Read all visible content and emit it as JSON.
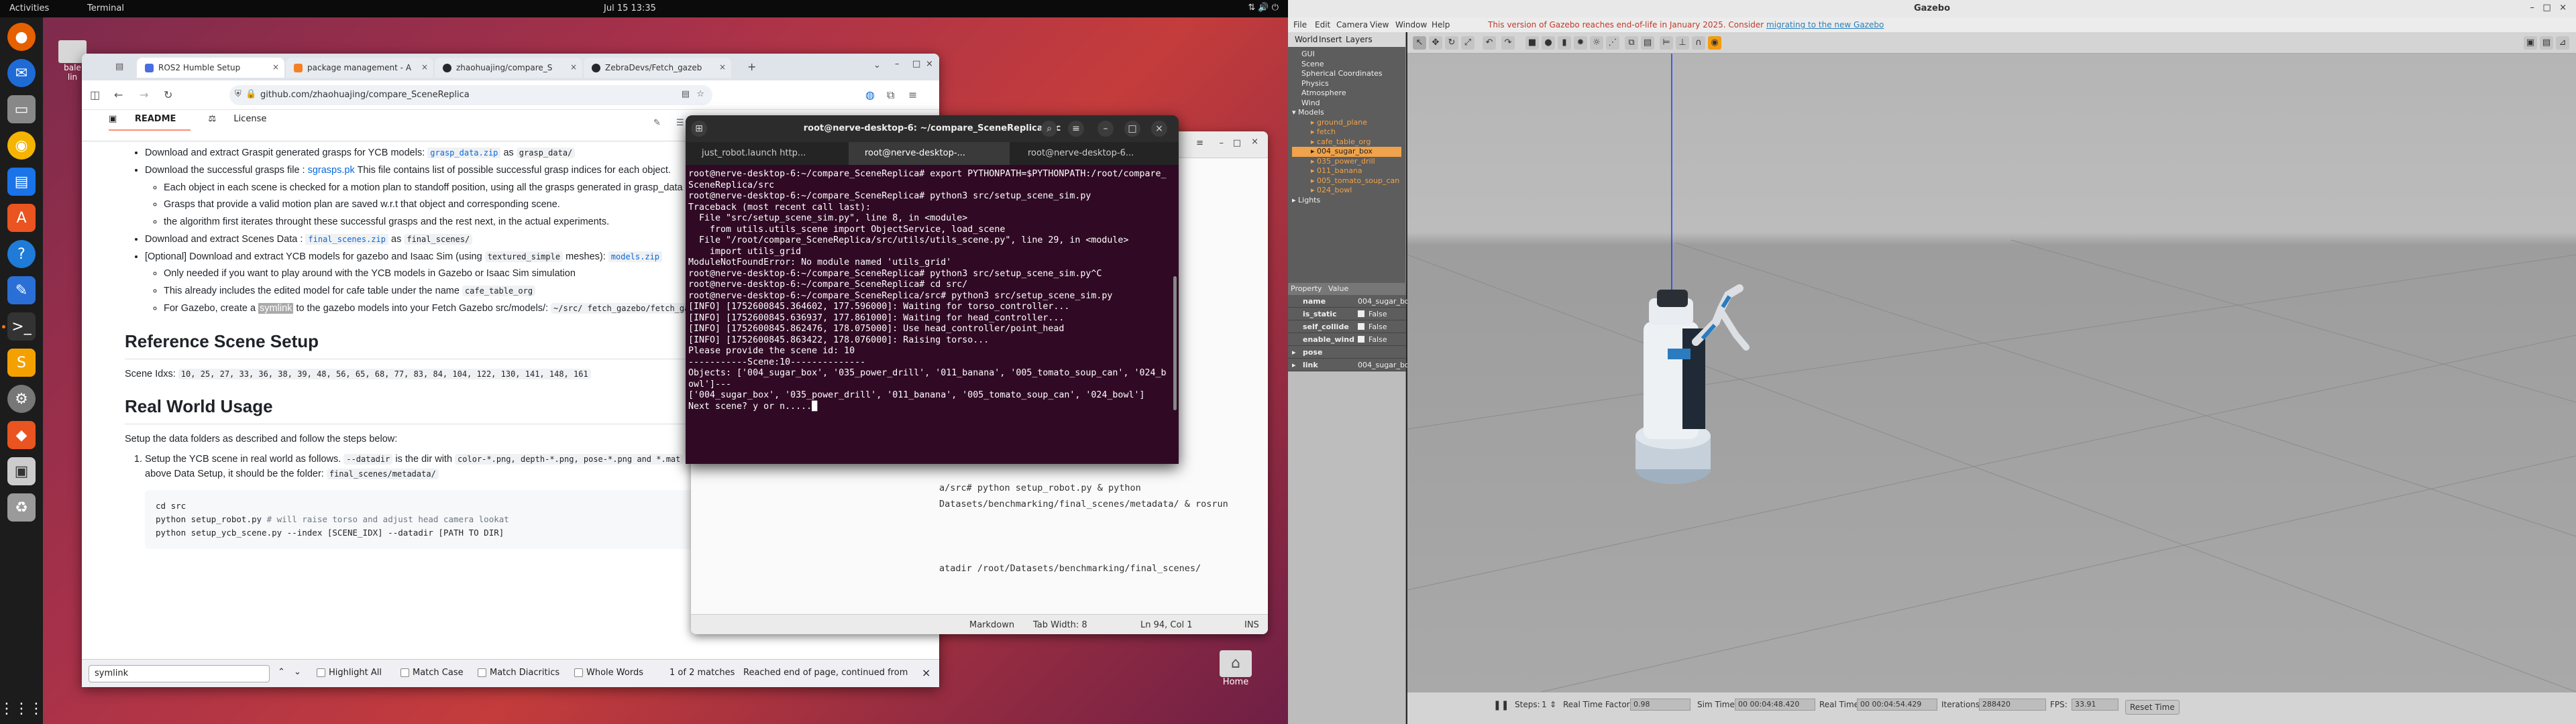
{
  "topbar": {
    "activities": "Activities",
    "app": "Terminal",
    "clock": "Jul 15  13:35"
  },
  "desktop": {
    "folder_label": "bale\nlin",
    "home_label": "Home"
  },
  "browser": {
    "tabs": [
      {
        "label": "ROS2 Humble Setup",
        "color": "#4a6ee0"
      },
      {
        "label": "package management - A",
        "color": "#f48024"
      },
      {
        "label": "zhaohuajing/compare_S",
        "color": "#24292f"
      },
      {
        "label": "ZebraDevs/Fetch_gazeb",
        "color": "#24292f"
      }
    ],
    "url": "github.com/zhaohuajing/compare_SceneReplica",
    "readme_tab": "README",
    "license_tab": "License",
    "doc": {
      "b1_pre": "Download and extract Graspit generated grasps for YCB models: ",
      "b1_code1": "grasp_data.zip",
      "b1_mid": " as ",
      "b1_code2": "grasp_data/",
      "b2_pre": "Download the successful grasps file : ",
      "b2_link": "sgrasps.pk",
      "b2_post": " This file contains list of possible successful grasp indices for each object.",
      "s1": "Each object in each scene is checked for a motion plan to standoff position, using all the grasps generated in grasp_data",
      "s2": "Grasps that provide a valid motion plan are saved w.r.t that object and corresponding scene.",
      "s3": "the algorithm first iterates throught these successful grasps and the rest next, in the actual experiments.",
      "b3_pre": "Download and extract Scenes Data : ",
      "b3_code1": "final_scenes.zip",
      "b3_mid": " as ",
      "b3_code2": "final_scenes/",
      "b4_pre": "[Optional] Download and extract YCB models for gazebo and Isaac Sim (using ",
      "b4_code": "textured_simple",
      "b4_post": " meshes): ",
      "b4_link": "models.zip",
      "o1": "Only needed if you want to play around with the YCB models in Gazebo or Isaac Sim simulation",
      "o2_pre": "This already includes the edited model for cafe table under the name ",
      "o2_code": "cafe_table_org",
      "o3_pre": "For Gazebo, create a ",
      "o3_hl": "symlink",
      "o3_mid": " to the gazebo models into your Fetch Gazebo src/models/: ",
      "o3_code": "~/src/ fetch_gazebo/fetch_gazebo/models",
      "h_ref": "Reference Scene Setup",
      "scene_label": "Scene Idxs: ",
      "scene_idxs": "10, 25, 27, 33, 36, 38, 39, 48, 56, 65, 68, 77, 83, 84, 104, 122, 130, 141, 148, 161",
      "h_real": "Real World Usage",
      "real_p": "Setup the data folders as described and follow the steps below:",
      "ol1_pre": "Setup the YCB scene in real world as follows. ",
      "ol1_c1": "--datadir",
      "ol1_mid": " is the dir with ",
      "ol1_c2": "color-*.png, depth-*.png, pose-*.png and *.mat",
      "ol1_mid2": " info files. Using the above Data Setup, it should be the folder: ",
      "ol1_c3": "final_scenes/metadata/",
      "code_l1": "cd src",
      "code_l2": "python setup_robot.py ",
      "code_l2c": "# will raise torso and adjust head camera lookat",
      "code_l3": "python setup_ycb_scene.py --index [SCENE_IDX] --datadir [PATH TO DIR]"
    },
    "find": {
      "value": "symlink",
      "highlight_all": "Highlight All",
      "match_case": "Match Case",
      "match_diacritics": "Match Diacritics",
      "whole_words": "Whole Words",
      "count": "1 of 2 matches",
      "status": "Reached end of page, continued from"
    }
  },
  "editor": {
    "lines": "a/src# python setup_robot.py & python\nDatasets/benchmarking/final_scenes/metadata/ & rosrun\n\n\n\natadir /root/Datasets/benchmarking/final_scenes/",
    "status": {
      "lang": "Markdown",
      "tab": "Tab Width: 8",
      "pos": "Ln 94, Col 1",
      "ins": "INS"
    }
  },
  "terminal": {
    "title": "root@nerve-desktop-6: ~/compare_SceneReplica/src",
    "tabs": [
      "just_robot.launch http...",
      "root@nerve-desktop-...",
      "root@nerve-desktop-6..."
    ],
    "output": "root@nerve-desktop-6:~/compare_SceneReplica# export PYTHONPATH=$PYTHONPATH:/root/compare_SceneReplica/src\nroot@nerve-desktop-6:~/compare_SceneReplica# python3 src/setup_scene_sim.py\nTraceback (most recent call last):\n  File \"src/setup_scene_sim.py\", line 8, in <module>\n    from utils.utils_scene import ObjectService, load_scene\n  File \"/root/compare_SceneReplica/src/utils/utils_scene.py\", line 29, in <module>\n    import utils_grid\nModuleNotFoundError: No module named 'utils_grid'\nroot@nerve-desktop-6:~/compare_SceneReplica# python3 src/setup_scene_sim.py^C\nroot@nerve-desktop-6:~/compare_SceneReplica# cd src/\nroot@nerve-desktop-6:~/compare_SceneReplica/src# python3 src/setup_scene_sim.py\n[INFO] [1752600845.364602, 177.596000]: Waiting for torso_controller...\n[INFO] [1752600845.636937, 177.861000]: Waiting for head_controller...\n[INFO] [1752600845.862476, 178.075000]: Use head_controller/point_head\n[INFO] [1752600845.863422, 178.076000]: Raising torso...\nPlease provide the scene id: 10\n-----------Scene:10--------------\nObjects: ['004_sugar_box', '035_power_drill', '011_banana', '005_tomato_soup_can', '024_bowl']---\n['004_sugar_box', '035_power_drill', '011_banana', '005_tomato_soup_can', '024_bowl']\nNext scene? y or n.....█"
  },
  "gazebo": {
    "title": "Gazebo",
    "menu": [
      "File",
      "Edit",
      "Camera",
      "View",
      "Window",
      "Help"
    ],
    "warning_pre": "This version of Gazebo reaches end-of-life in January 2025. Consider ",
    "warning_link": "migrating to the new Gazebo",
    "left_tabs": [
      "World",
      "Insert",
      "Layers"
    ],
    "tree": {
      "root": [
        "GUI",
        "Scene",
        "Spherical Coordinates",
        "Physics",
        "Atmosphere",
        "Wind"
      ],
      "models_label": "Models",
      "models": [
        "ground_plane",
        "fetch",
        "cafe_table_org",
        "004_sugar_box",
        "035_power_drill",
        "011_banana",
        "005_tomato_soup_can",
        "024_bowl"
      ],
      "lights": "Lights"
    },
    "prop_header": {
      "k": "Property",
      "v": "Value"
    },
    "props": [
      {
        "k": "name",
        "v": "004_sugar_box"
      },
      {
        "k": "is_static",
        "v": "False"
      },
      {
        "k": "self_collide",
        "v": "False"
      },
      {
        "k": "enable_wind",
        "v": "False"
      },
      {
        "k": "pose",
        "v": ""
      },
      {
        "k": "link",
        "v": "004_sugar_box..."
      }
    ],
    "bottom": {
      "steps_label": "Steps:",
      "steps": "1",
      "rtf_label": "Real Time Factor:",
      "rtf": "0.98",
      "sim_label": "Sim Time:",
      "sim": "00 00:04:48.420",
      "real_label": "Real Time:",
      "real": "00 00:04:54.429",
      "iter_label": "Iterations:",
      "iter": "288420",
      "fps_label": "FPS:",
      "fps": "33.91",
      "reset": "Reset Time"
    }
  }
}
